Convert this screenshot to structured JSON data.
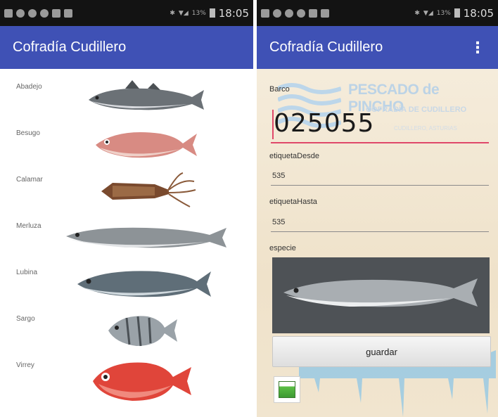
{
  "status_bar": {
    "time": "18:05",
    "battery": "13%"
  },
  "left_screen": {
    "app_title": "Cofradía Cudillero",
    "fish": [
      {
        "label": "Abadejo",
        "icon": "pollock-fish-image"
      },
      {
        "label": "Besugo",
        "icon": "sea-bream-fish-image"
      },
      {
        "label": "Calamar",
        "icon": "squid-image"
      },
      {
        "label": "Merluza",
        "icon": "hake-fish-image"
      },
      {
        "label": "Lubina",
        "icon": "sea-bass-fish-image"
      },
      {
        "label": "Sargo",
        "icon": "white-bream-fish-image"
      },
      {
        "label": "Virrey",
        "icon": "alfonsino-fish-image"
      }
    ]
  },
  "right_screen": {
    "app_title": "Cofradía Cudillero",
    "menu_icon": "overflow-menu-icon",
    "watermark": {
      "title": "PESCADO de PINCHO",
      "subtitle": "COFRADÍA DE CUDILLERO",
      "tagline": "CUDILLERO, ASTURIAS"
    },
    "barco_label": "Barco",
    "barco_value": "025055",
    "etiqueta_desde_label": "etiquetaDesde",
    "etiqueta_desde_value": "535",
    "etiqueta_hasta_label": "etiquetaHasta",
    "etiqueta_hasta_value": "535",
    "especie_label": "especie",
    "especie_image": "hake-fish-photo",
    "save_button": "guardar",
    "thumbnail_icon": "gallery-thumbnail-icon"
  },
  "colors": {
    "app_bar": "#3f51b5",
    "status_bar": "#131313",
    "accent": "#e0486a",
    "form_bg": "#f3e9d7"
  }
}
